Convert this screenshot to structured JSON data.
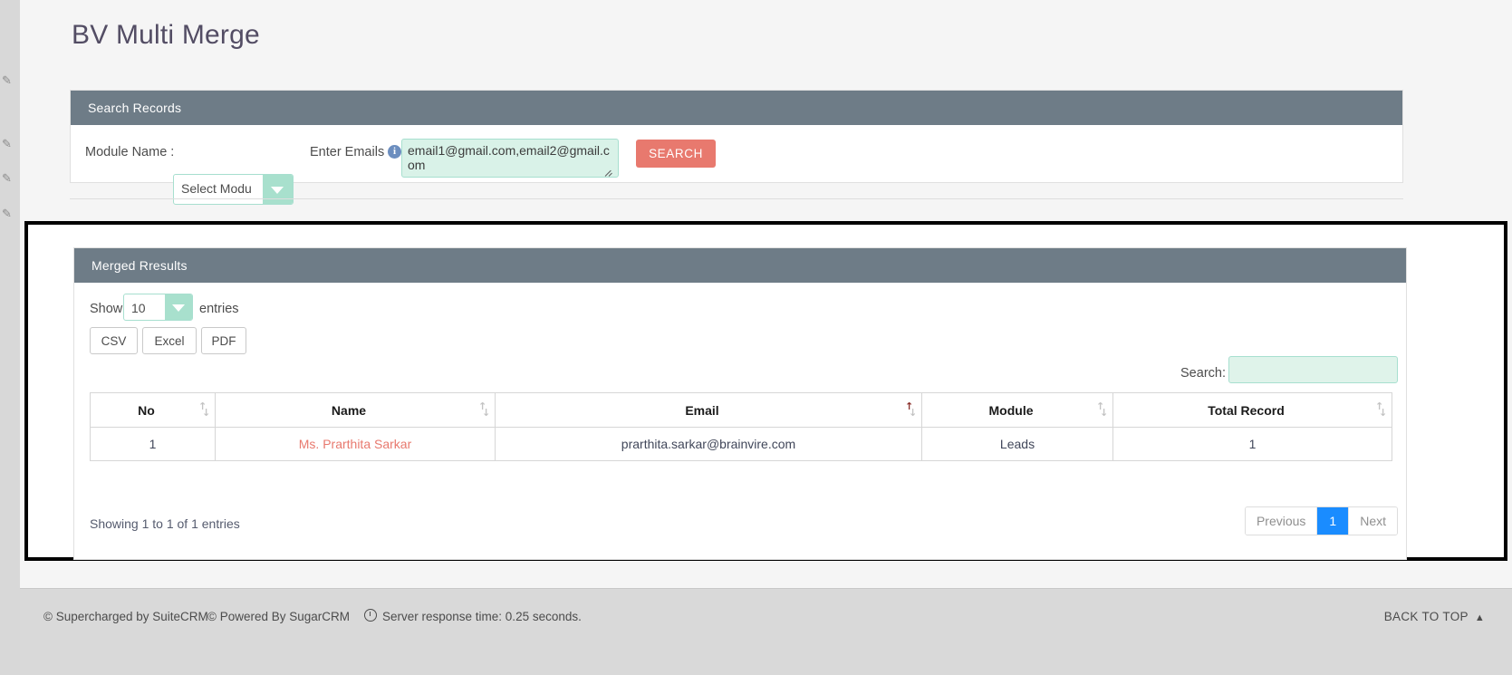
{
  "page": {
    "title": "BV Multi Merge"
  },
  "sidebar": {
    "icons": [
      "pencil-icon",
      "pencil-icon",
      "pencil-icon",
      "pencil-icon",
      "pencil-icon"
    ],
    "glyph": "✎"
  },
  "search_panel": {
    "header": "Search Records",
    "module_label": "Module Name :",
    "module_select_value": "Select Modu",
    "emails_label": "Enter Emails :",
    "info_icon_glyph": "i",
    "emails_value": "email1@gmail.com,email2@gmail.com",
    "emails_placeholder": "email1@gmail.com,email2@gmail.com",
    "search_button": "SEARCH"
  },
  "results_panel": {
    "header": "Merged Rresults",
    "show_label": "Show",
    "page_length": "10",
    "entries_label": "entries",
    "export_buttons": [
      {
        "name": "csv",
        "label": "CSV"
      },
      {
        "name": "excel",
        "label": "Excel"
      },
      {
        "name": "pdf",
        "label": "PDF"
      }
    ],
    "filter_label": "Search:",
    "filter_value": "",
    "filter_placeholder": "",
    "columns": [
      {
        "label": "No",
        "sorted": false
      },
      {
        "label": "Name",
        "sorted": false
      },
      {
        "label": "Email",
        "sorted": true
      },
      {
        "label": "Module",
        "sorted": false
      },
      {
        "label": "Total Record",
        "sorted": false
      }
    ],
    "rows": [
      {
        "no": "1",
        "name": "Ms. Prarthita Sarkar",
        "email": "prarthita.sarkar@brainvire.com",
        "module": "Leads",
        "total_record": "1"
      }
    ],
    "showing_info": "Showing 1 to 1 of 1 entries",
    "pagination": {
      "previous": "Previous",
      "pages": [
        "1"
      ],
      "active_page": "1",
      "next": "Next"
    }
  },
  "footer": {
    "suitecrm": "© Supercharged by SuiteCRM",
    "sugarcrm": "© Powered By SugarCRM",
    "response_time": "Server response time: 0.25 seconds.",
    "back_to_top": "BACK TO TOP",
    "back_to_top_caret": "▲"
  },
  "colors": {
    "panel_header": "#6e7c87",
    "accent_mint": "#a8e0cd",
    "accent_salmon": "#e8796e",
    "pagination_active": "#1a8cff",
    "sort_active": "#8a2f2a"
  }
}
